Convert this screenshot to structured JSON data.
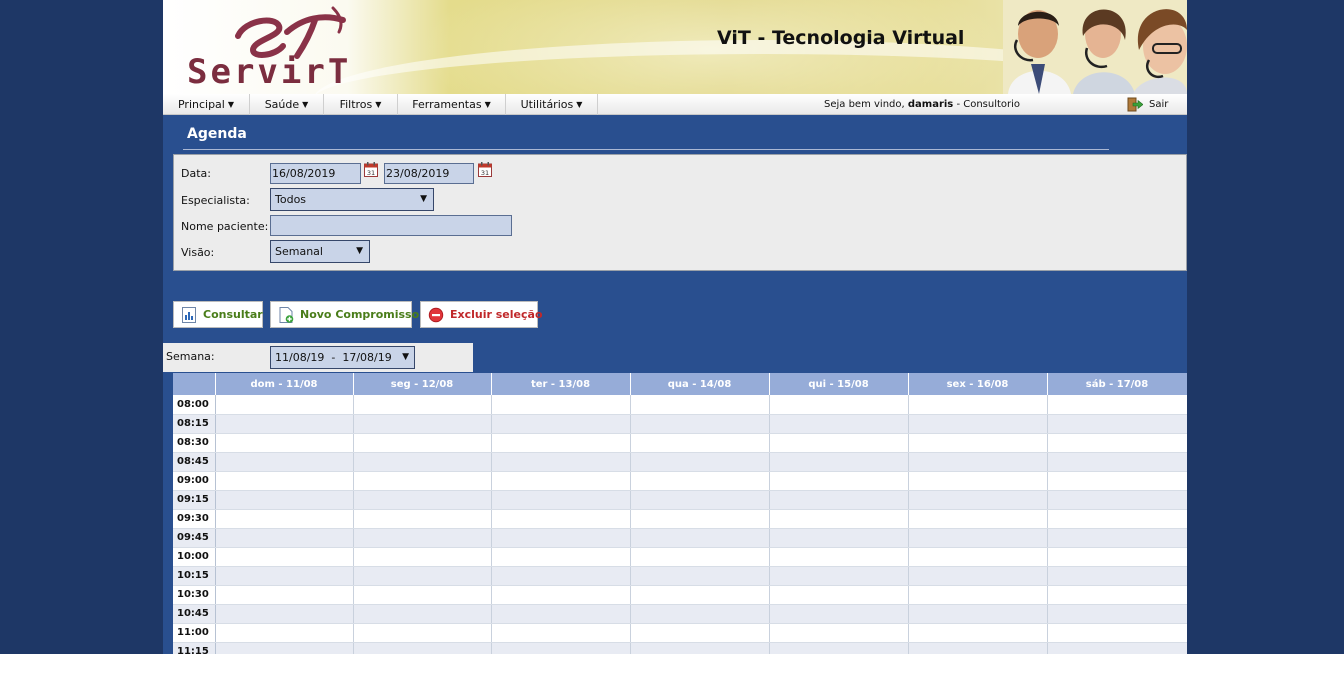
{
  "banner": {
    "logo_text": "ServirT",
    "logo_mark": "ST",
    "title": "ViT - Tecnologia Virtual"
  },
  "menu": {
    "items": [
      {
        "label": "Principal"
      },
      {
        "label": "Saúde"
      },
      {
        "label": "Filtros"
      },
      {
        "label": "Ferramentas"
      },
      {
        "label": "Utilitários"
      }
    ],
    "welcome_prefix": "Seja bem vindo,",
    "user": "damaris",
    "role": " - Consultorio",
    "logout": "Sair"
  },
  "section": {
    "title": "Agenda"
  },
  "filters": {
    "date_label": "Data:",
    "date_from": "16/08/2019",
    "date_to": "23/08/2019",
    "specialist_label": "Especialista:",
    "specialist_value": "Todos",
    "patient_label": "Nome paciente:",
    "patient_value": "",
    "view_label": "Visão:",
    "view_value": "Semanal"
  },
  "actions": {
    "consult": "Consultar",
    "new": "Novo Compromisso",
    "delete": "Excluir seleção"
  },
  "week": {
    "label": "Semana:",
    "value": "11/08/19  -  17/08/19"
  },
  "calendar": {
    "days": [
      "dom - 11/08",
      "seg - 12/08",
      "ter - 13/08",
      "qua - 14/08",
      "qui - 15/08",
      "sex - 16/08",
      "sáb - 17/08"
    ],
    "times": [
      "08:00",
      "08:15",
      "08:30",
      "08:45",
      "09:00",
      "09:15",
      "09:30",
      "09:45",
      "10:00",
      "10:15",
      "10:30",
      "10:45",
      "11:00",
      "11:15"
    ]
  },
  "colors": {
    "page_bg": "#1e3766",
    "content_bg": "#294f8f",
    "header_row": "#96acd8",
    "consult_text": "#4a7d1a",
    "new_text": "#4a7d1a",
    "delete_text": "#c0282a"
  }
}
